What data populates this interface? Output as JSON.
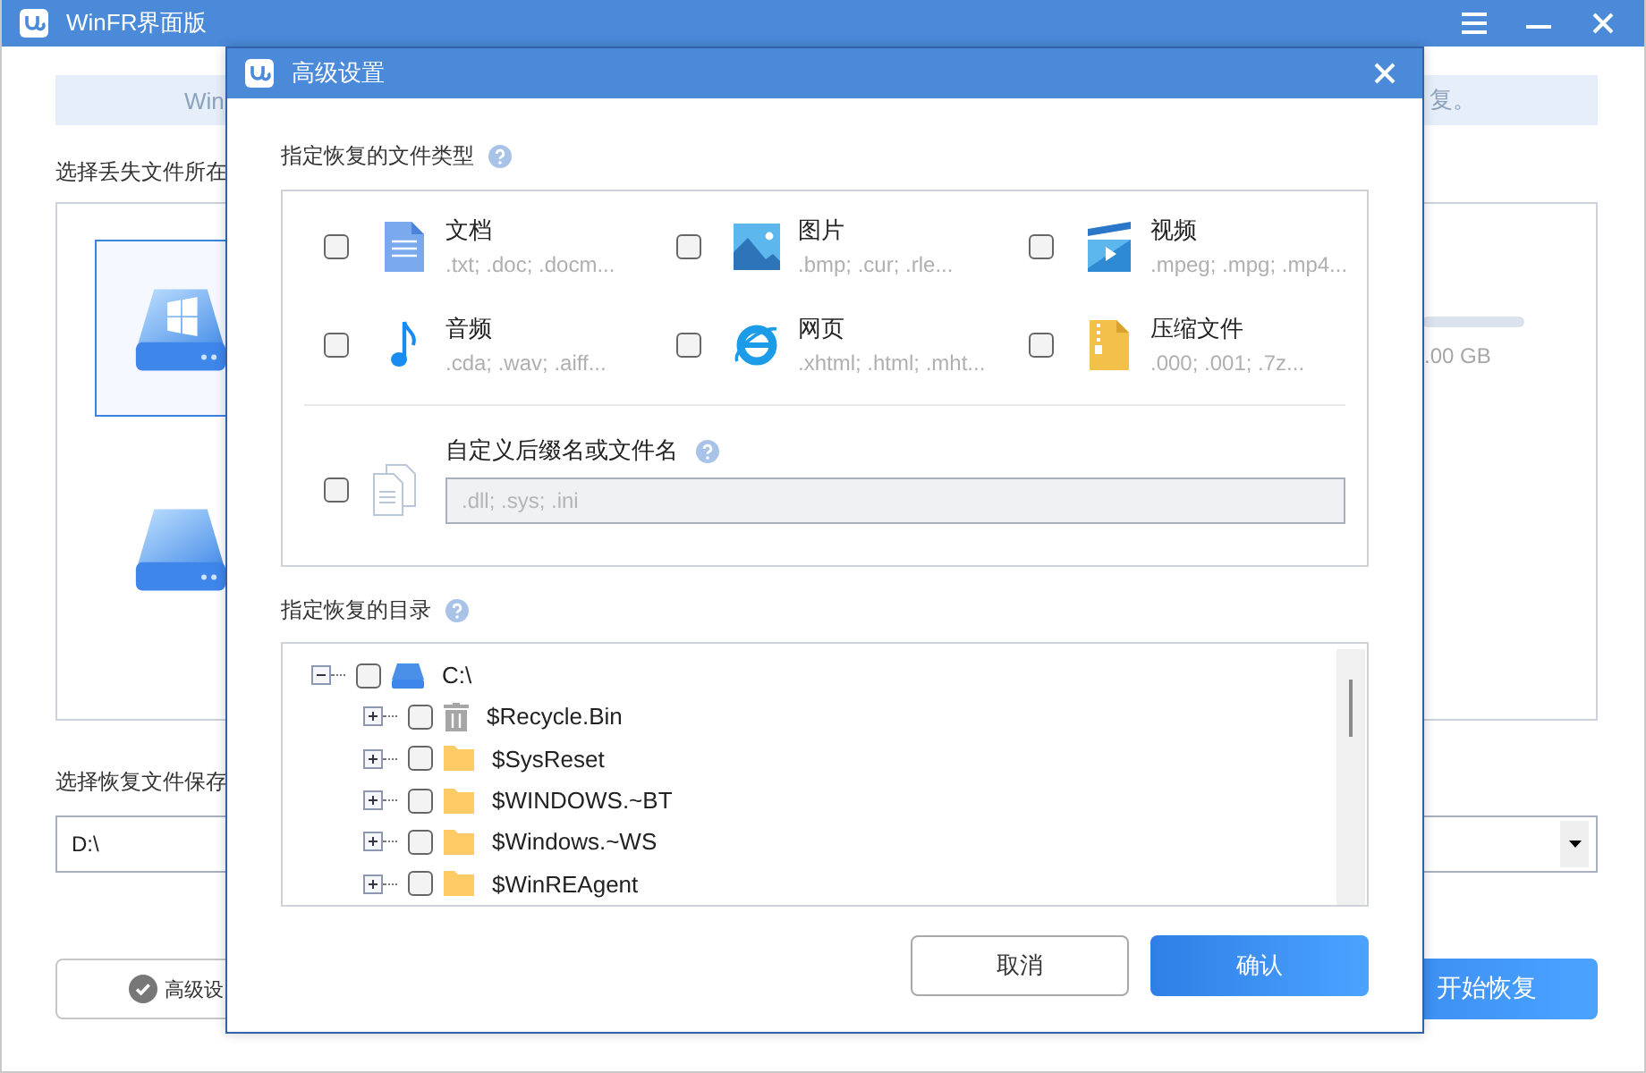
{
  "window": {
    "title": "WinFR界面版"
  },
  "banner": {
    "left_text": "Win",
    "right_text": "复。"
  },
  "source_label": "选择丢失文件所在",
  "drives": [
    {
      "kind": "system",
      "selected": true
    },
    {
      "kind": "disk",
      "selected": false
    }
  ],
  "disk_size": ".00 GB",
  "save_label": "选择恢复文件保存",
  "save_path": "D:\\",
  "advanced_button": "高级设",
  "start_button": "开始恢复",
  "dialog": {
    "title": "高级设置",
    "file_types_label": "指定恢复的文件类型",
    "file_types": [
      {
        "kind": "document",
        "name": "文档",
        "extensions": ".txt; .doc; .docm...",
        "checked": false
      },
      {
        "kind": "image",
        "name": "图片",
        "extensions": ".bmp; .cur; .rle...",
        "checked": false
      },
      {
        "kind": "video",
        "name": "视频",
        "extensions": ".mpeg; .mpg; .mp4...",
        "checked": false
      },
      {
        "kind": "audio",
        "name": "音频",
        "extensions": ".cda; .wav; .aiff...",
        "checked": false
      },
      {
        "kind": "web",
        "name": "网页",
        "extensions": ".xhtml; .html; .mht...",
        "checked": false
      },
      {
        "kind": "archive",
        "name": "压缩文件",
        "extensions": ".000; .001; .7z...",
        "checked": false
      }
    ],
    "custom": {
      "label": "自定义后缀名或文件名",
      "checked": false,
      "placeholder": ".dll; .sys; .ini"
    },
    "directory_label": "指定恢复的目录",
    "tree": [
      {
        "kind": "drive",
        "label": "C:\\",
        "expanded": true,
        "checked": false,
        "children": [
          {
            "kind": "recycle",
            "label": "$Recycle.Bin",
            "expanded": false,
            "checked": false
          },
          {
            "kind": "folder",
            "label": "$SysReset",
            "expanded": false,
            "checked": false
          },
          {
            "kind": "folder",
            "label": "$WINDOWS.~BT",
            "expanded": false,
            "checked": false
          },
          {
            "kind": "folder",
            "label": "$Windows.~WS",
            "expanded": false,
            "checked": false
          },
          {
            "kind": "folder",
            "label": "$WinREAgent",
            "expanded": false,
            "checked": false
          }
        ]
      }
    ],
    "cancel_button": "取消",
    "confirm_button": "确认"
  }
}
